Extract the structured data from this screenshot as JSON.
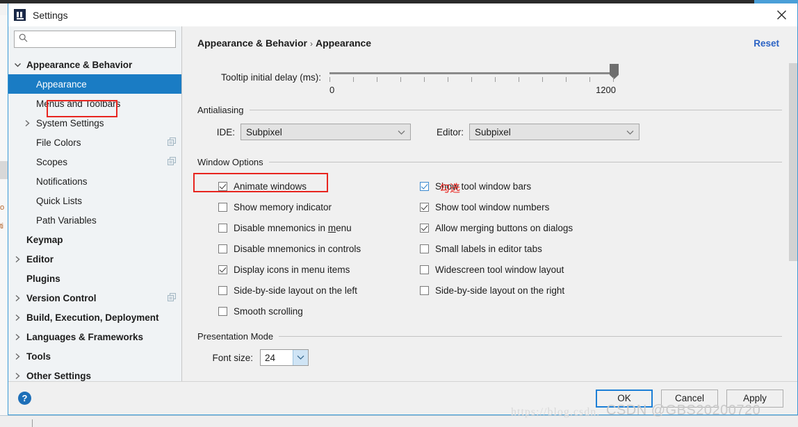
{
  "window": {
    "title": "Settings",
    "app_icon": "intellij-idea-icon",
    "close_icon": "close-icon"
  },
  "search": {
    "placeholder": "",
    "value": "",
    "icon": "search-icon"
  },
  "sidebar": {
    "items": [
      {
        "label": "Appearance & Behavior",
        "level": "top",
        "expander": "chevron-down-icon",
        "selected": false,
        "copy_icon": false
      },
      {
        "label": "Appearance",
        "level": "child",
        "expander": "none",
        "selected": true,
        "copy_icon": false
      },
      {
        "label": "Menus and Toolbars",
        "level": "child",
        "expander": "none",
        "selected": false,
        "copy_icon": false
      },
      {
        "label": "System Settings",
        "level": "child",
        "expander": "chevron-right-icon",
        "selected": false,
        "copy_icon": false
      },
      {
        "label": "File Colors",
        "level": "child",
        "expander": "none",
        "selected": false,
        "copy_icon": true
      },
      {
        "label": "Scopes",
        "level": "child",
        "expander": "none",
        "selected": false,
        "copy_icon": true
      },
      {
        "label": "Notifications",
        "level": "child",
        "expander": "none",
        "selected": false,
        "copy_icon": false
      },
      {
        "label": "Quick Lists",
        "level": "child",
        "expander": "none",
        "selected": false,
        "copy_icon": false
      },
      {
        "label": "Path Variables",
        "level": "child",
        "expander": "none",
        "selected": false,
        "copy_icon": false
      },
      {
        "label": "Keymap",
        "level": "top",
        "expander": "none",
        "selected": false,
        "copy_icon": false
      },
      {
        "label": "Editor",
        "level": "top",
        "expander": "chevron-right-icon",
        "selected": false,
        "copy_icon": false
      },
      {
        "label": "Plugins",
        "level": "top",
        "expander": "none",
        "selected": false,
        "copy_icon": false
      },
      {
        "label": "Version Control",
        "level": "top",
        "expander": "chevron-right-icon",
        "selected": false,
        "copy_icon": true
      },
      {
        "label": "Build, Execution, Deployment",
        "level": "top",
        "expander": "chevron-right-icon",
        "selected": false,
        "copy_icon": false
      },
      {
        "label": "Languages & Frameworks",
        "level": "top",
        "expander": "chevron-right-icon",
        "selected": false,
        "copy_icon": false
      },
      {
        "label": "Tools",
        "level": "top",
        "expander": "chevron-right-icon",
        "selected": false,
        "copy_icon": false
      },
      {
        "label": "Other Settings",
        "level": "top",
        "expander": "chevron-right-icon",
        "selected": false,
        "copy_icon": false
      }
    ]
  },
  "main": {
    "breadcrumb": {
      "parent": "Appearance & Behavior",
      "separator": "›",
      "current": "Appearance"
    },
    "reset_label": "Reset",
    "tooltip_delay": {
      "label": "Tooltip initial delay (ms):",
      "min_label": "0",
      "max_label": "1200",
      "value": 1200,
      "tick_count": 13
    },
    "antialiasing": {
      "group_label": "Antialiasing",
      "ide_label": "IDE:",
      "ide_value": "Subpixel",
      "editor_label": "Editor:",
      "editor_value": "Subpixel",
      "dropdown_icon": "chevron-down-icon"
    },
    "window_options": {
      "group_label": "Window Options",
      "left_column": [
        {
          "label": "Animate windows",
          "checked": true,
          "mnemonic": ""
        },
        {
          "label": "Show memory indicator",
          "checked": false,
          "mnemonic": ""
        },
        {
          "label": "Disable mnemonics in menu",
          "checked": false,
          "mnemonic": "m"
        },
        {
          "label": "Disable mnemonics in controls",
          "checked": false,
          "mnemonic": ""
        },
        {
          "label": "Display icons in menu items",
          "checked": true,
          "mnemonic": ""
        },
        {
          "label": "Side-by-side layout on the left",
          "checked": false,
          "mnemonic": ""
        },
        {
          "label": "Smooth scrolling",
          "checked": false,
          "mnemonic": ""
        }
      ],
      "right_column": [
        {
          "label": "Show tool window bars",
          "checked": true,
          "highlighted": true
        },
        {
          "label": "Show tool window numbers",
          "checked": true,
          "highlighted": false
        },
        {
          "label": "Allow merging buttons on dialogs",
          "checked": true,
          "highlighted": false
        },
        {
          "label": "Small labels in editor tabs",
          "checked": false,
          "highlighted": false
        },
        {
          "label": "Widescreen tool window layout",
          "checked": false,
          "highlighted": false
        },
        {
          "label": "Side-by-side layout on the right",
          "checked": false,
          "highlighted": false
        }
      ]
    },
    "presentation_mode": {
      "group_label": "Presentation Mode",
      "font_size_label": "Font size:",
      "font_size_value": "24",
      "dropdown_icon": "chevron-down-icon"
    }
  },
  "annotations": {
    "chinese_note": "勾选",
    "color": "#e8251f"
  },
  "footer": {
    "help_icon": "help-icon",
    "help_glyph": "?",
    "buttons": [
      {
        "label": "OK",
        "default": true
      },
      {
        "label": "Cancel",
        "default": false
      },
      {
        "label": "Apply",
        "default": false
      }
    ]
  },
  "watermarks": {
    "url": "https://blog.csdn.",
    "csdn": "CSDN @GBS20200720"
  },
  "colors": {
    "selection": "#1a7cc4",
    "link": "#2a62c4",
    "annotation": "#e8251f",
    "dialog_border": "#3c9ad6"
  },
  "background_ide": {
    "ghost_labels": [
      "o",
      "ti"
    ]
  }
}
